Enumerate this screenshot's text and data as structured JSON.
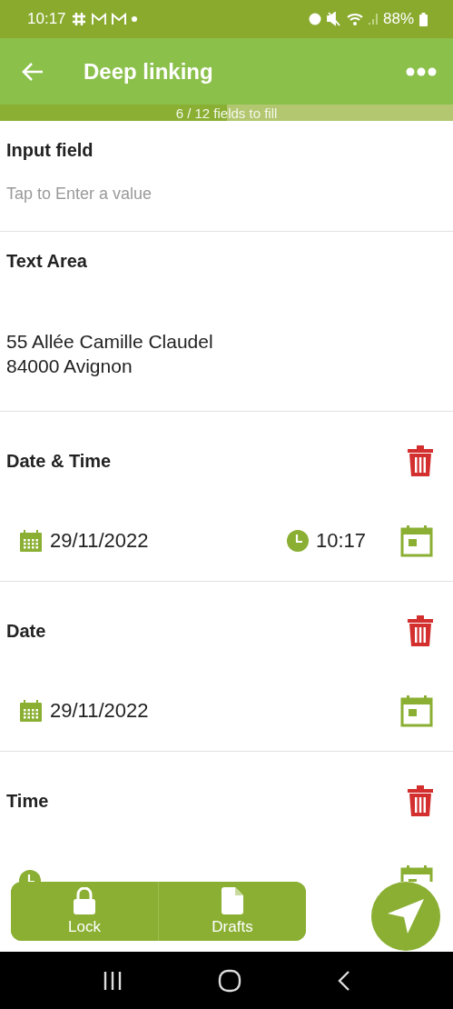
{
  "status_bar": {
    "time": "10:17",
    "battery": "88%"
  },
  "app_bar": {
    "title": "Deep linking"
  },
  "progress": {
    "label": "6 / 12 fields to fill",
    "level": 0.5
  },
  "fields": [
    {
      "kind": "text",
      "label": "Input field",
      "placeholder": "Tap to Enter a value"
    },
    {
      "kind": "textarea",
      "label": "Text Area",
      "value": "55 Allée Camille Claudel\n84000 Avignon"
    },
    {
      "kind": "datetime",
      "label": "Date & Time",
      "date": "29/11/2022",
      "time": "10:17"
    },
    {
      "kind": "date",
      "label": "Date",
      "date": "29/11/2022"
    },
    {
      "kind": "time",
      "label": "Time"
    }
  ],
  "footer": {
    "buttons": [
      {
        "kind": "lock",
        "label": "Lock"
      },
      {
        "kind": "drafts",
        "label": "Drafts"
      }
    ]
  }
}
